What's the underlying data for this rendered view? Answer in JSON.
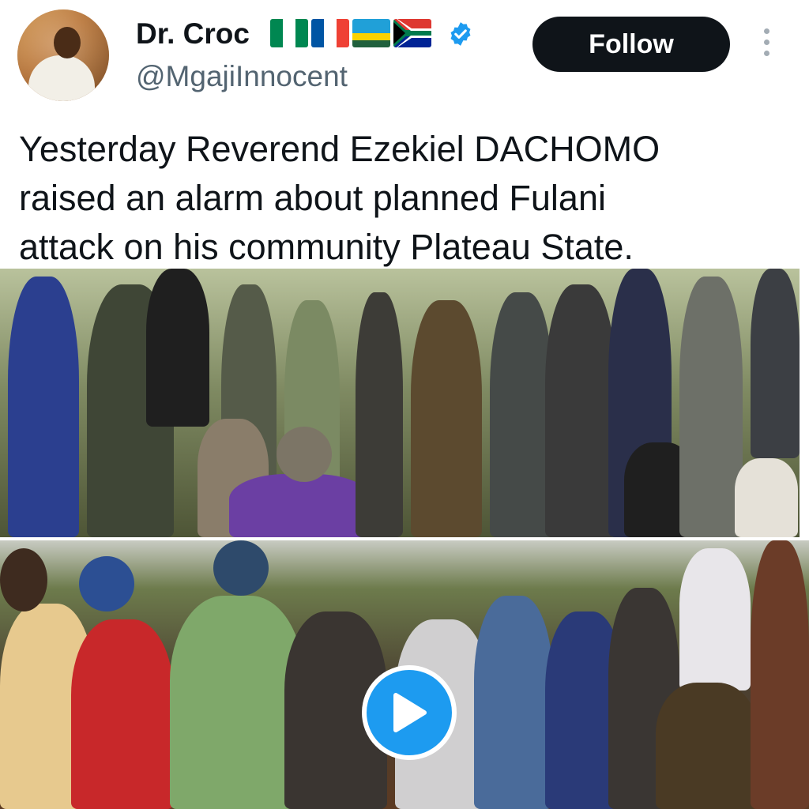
{
  "author": {
    "display_name": "Dr. Croc",
    "handle": "@MgajiInnocent",
    "flag_icons": [
      "nigeria-flag-icon",
      "france-flag-icon",
      "rwanda-flag-icon",
      "south-africa-flag-icon"
    ],
    "verified": true
  },
  "actions": {
    "follow_label": "Follow"
  },
  "tweet": {
    "lines": [
      "Yesterday Reverend Ezekiel DACHOMO",
      "raised an alarm about planned Fulani",
      "attack on his community Plateau State."
    ]
  },
  "colors": {
    "accent": "#1d9bf0",
    "text": "#0f1419",
    "muted": "#536471",
    "follow_bg": "#0f1419"
  }
}
